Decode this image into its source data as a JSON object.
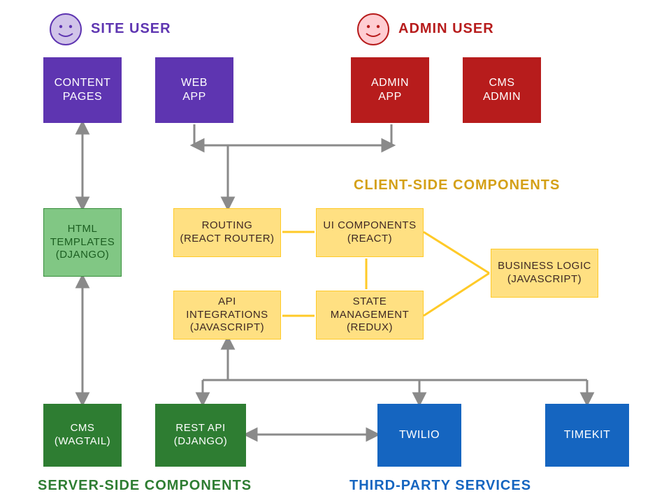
{
  "titles": {
    "site_user": "SITE USER",
    "admin_user": "ADMIN USER",
    "client_side": "CLIENT-SIDE COMPONENTS",
    "server_side": "SERVER-SIDE COMPONENTS",
    "third_party": "THIRD-PARTY SERVICES"
  },
  "boxes": {
    "content_pages": "CONTENT\nPAGES",
    "web_app": "WEB\nAPP",
    "admin_app": "ADMIN\nAPP",
    "cms_admin": "CMS\nADMIN",
    "html_templates": "HTML\nTEMPLATES\n(DJANGO)",
    "routing": "ROUTING\n(REACT ROUTER)",
    "ui_components": "UI COMPONENTS\n(REACT)",
    "business_logic": "BUSINESS LOGIC\n(JAVASCRIPT)",
    "api_integrations": "API\nINTEGRATIONS\n(JAVASCRIPT)",
    "state_mgmt": "STATE\nMANAGEMENT\n(REDUX)",
    "cms": "CMS\n(WAGTAIL)",
    "rest_api": "REST API\n(DJANGO)",
    "twilio": "TWILIO",
    "timekit": "TIMEKIT"
  },
  "colors": {
    "purple": "#5e35b1",
    "red": "#b71c1c",
    "light_green": "#81c784",
    "yellow": "#ffe082",
    "dark_green": "#2e7d32",
    "blue": "#1565c0",
    "arrow": "#8a8a8a",
    "connector": "#ffca28"
  },
  "icons": {
    "site_face": "site-user-face-icon",
    "admin_face": "admin-user-face-icon"
  }
}
